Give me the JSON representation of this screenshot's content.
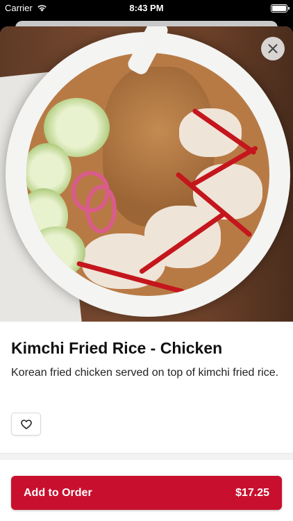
{
  "status_bar": {
    "carrier": "Carrier",
    "time": "8:43 PM",
    "wifi_icon": "wifi-icon",
    "battery_icon": "battery-icon"
  },
  "item": {
    "image_alt": "Kimchi Fried Rice - Chicken photo",
    "title": "Kimchi Fried Rice - Chicken",
    "description": "Korean fried chicken served on top of kimchi fried rice."
  },
  "actions": {
    "close_icon": "close-icon",
    "favorite_icon": "heart-icon",
    "add_label": "Add to Order",
    "price": "$17.25"
  },
  "colors": {
    "accent": "#c8102e"
  }
}
